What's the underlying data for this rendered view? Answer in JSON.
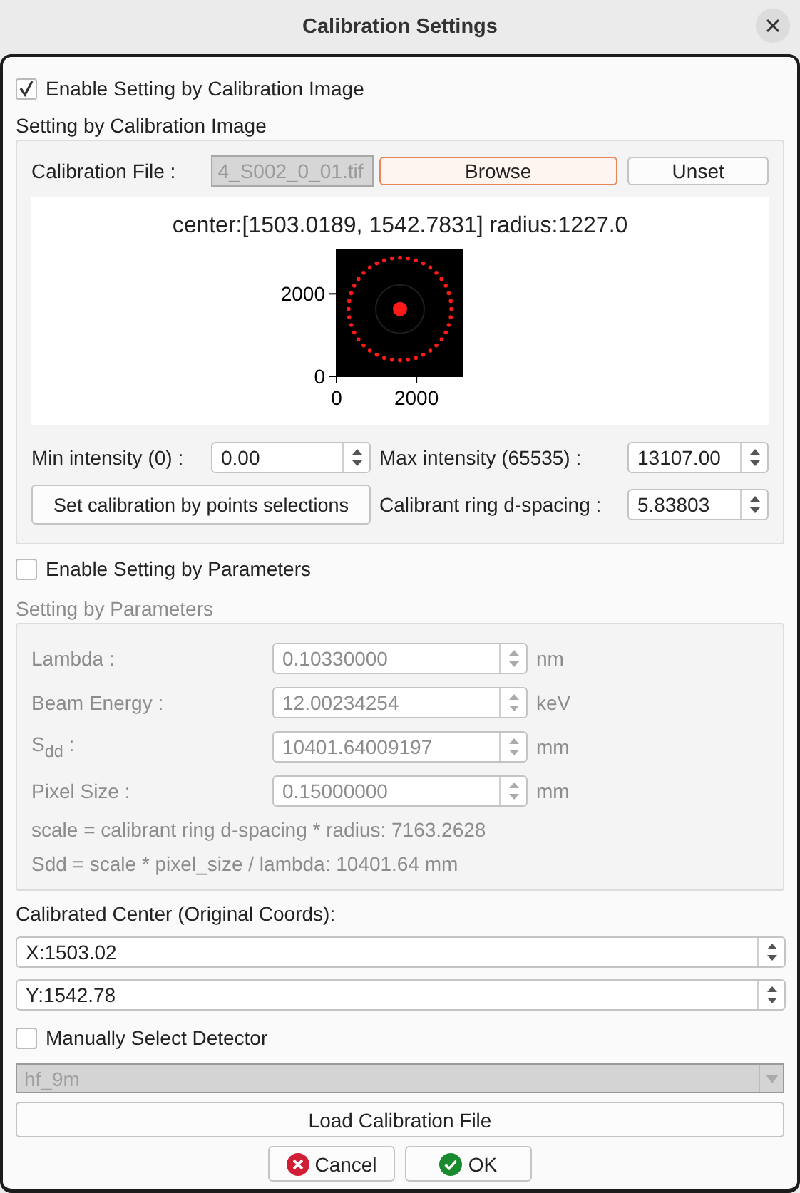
{
  "window": {
    "title": "Calibration Settings"
  },
  "image_section": {
    "enable": {
      "label": "Enable Setting by Calibration Image",
      "checked": true
    },
    "title": "Setting by Calibration Image",
    "file": {
      "label": "Calibration File :",
      "value": "4_S002_0_01.tif",
      "disabled": true
    },
    "browse_button": {
      "label": "Browse",
      "focused": true
    },
    "unset_button": {
      "label": "Unset",
      "focused": false
    },
    "plot": {
      "title": "center:[1503.0189, 1542.7831] radius:1227.0",
      "x_tick_labels": [
        "0",
        "2000"
      ],
      "y_tick_labels": [
        "2000",
        "0"
      ]
    },
    "min_intensity": {
      "label": "Min intensity (0) :",
      "value": "0.00"
    },
    "max_intensity": {
      "label": "Max intensity (65535) :",
      "value": "13107.00"
    },
    "points_button": "Set calibration by points selections",
    "d_spacing": {
      "label": "Calibrant ring d-spacing :",
      "value": "5.83803"
    }
  },
  "parameters_section": {
    "enable": {
      "label": "Enable Setting by Parameters",
      "checked": false
    },
    "title": "Setting by Parameters",
    "disabled": true,
    "fields": [
      {
        "label": "Lambda :",
        "value": "0.10330000",
        "unit": "nm"
      },
      {
        "label": "Beam Energy :",
        "value": "12.00234254",
        "unit": "keV"
      },
      {
        "label": "S$_{dd}$ :",
        "value": "10401.64009197",
        "unit": "mm"
      },
      {
        "label": "Pixel Size :",
        "value": "0.15000000",
        "unit": "mm"
      }
    ],
    "notes": [
      "scale = calibrant ring d-spacing * radius: 7163.2628",
      "Sdd = scale * pixel_size / lambda: 10401.64 mm"
    ]
  },
  "center": {
    "title": "Calibrated Center (Original Coords):",
    "x": "X:1503.02",
    "y": "Y:1542.78"
  },
  "detector": {
    "manual": {
      "label": "Manually Select Detector",
      "checked": false
    },
    "value": "hf_9m",
    "disabled": true
  },
  "load_button": "Load Calibration File",
  "buttons": [
    {
      "label": "Cancel",
      "kind": "cancel"
    },
    {
      "label": "OK",
      "kind": "ok"
    }
  ]
}
